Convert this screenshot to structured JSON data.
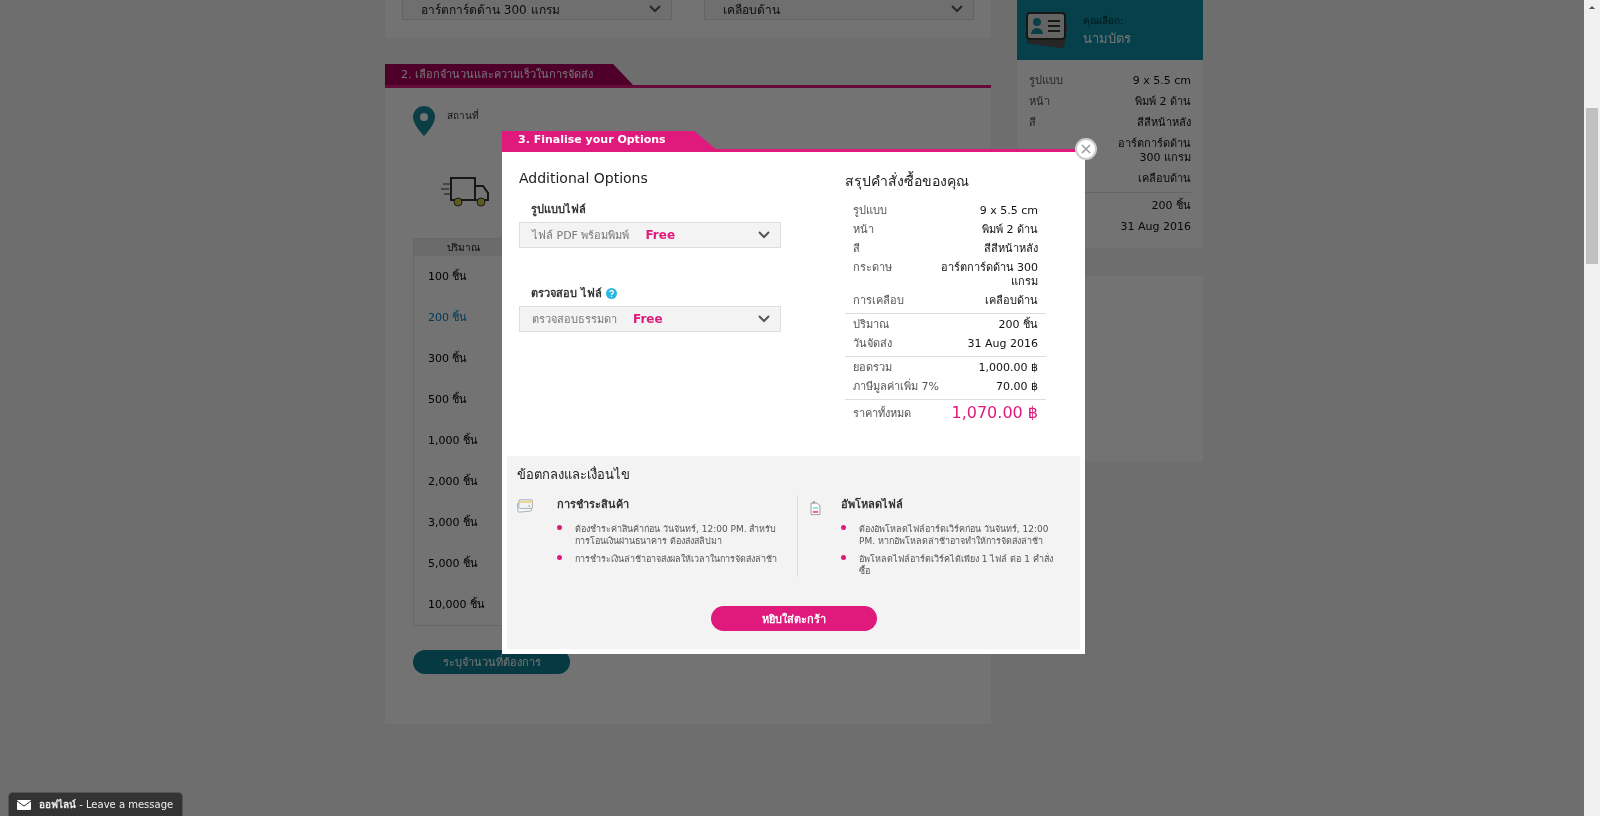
{
  "background": {
    "top_selects": [
      "อาร์ตการ์ดด้าน 300 แกรม",
      "เคลือบด้าน"
    ],
    "section_tab": "2. เลือกจำนวนและความเร็วในการจัดส่ง",
    "location_label": "สถานที่",
    "quantity": {
      "header": "ปริมาณ",
      "items": [
        {
          "label": "100 ชิ้น",
          "selected": false
        },
        {
          "label": "200 ชิ้น",
          "selected": true
        },
        {
          "label": "300 ชิ้น",
          "selected": false
        },
        {
          "label": "500 ชิ้น",
          "selected": false
        },
        {
          "label": "1,000 ชิ้น",
          "selected": false
        },
        {
          "label": "2,000 ชิ้น",
          "selected": false
        },
        {
          "label": "3,000 ชิ้น",
          "selected": false
        },
        {
          "label": "5,000 ชิ้น",
          "selected": false
        },
        {
          "label": "10,000 ชิ้น",
          "selected": false
        }
      ]
    },
    "custom_button": "ระบุจำนวนที่ต้องการ"
  },
  "sidebar": {
    "title_label": "คุณเลือก:",
    "product": "นามบัตร",
    "groups": [
      [
        {
          "label": "รูปแบบ",
          "value": "9 x 5.5 cm"
        },
        {
          "label": "หน้า",
          "value": "พิมพ์ 2 ด้าน"
        },
        {
          "label": "สี",
          "value": "สีสีหน้าหลัง"
        },
        {
          "value": "อาร์ตการ์ดด้าน 300 แกรม"
        },
        {
          "value": "เคลือบด้าน"
        }
      ],
      [
        {
          "value": "200  ชิ้น"
        },
        {
          "value": "31 Aug 2016"
        }
      ]
    ]
  },
  "modal": {
    "tab": "3. Finalise your Options",
    "options_title": "Additional Options",
    "options": [
      {
        "label": "รูปแบบไฟล์",
        "help": false,
        "value": "ไฟล์ PDF พร้อมพิมพ์",
        "price": "Free"
      },
      {
        "label": "ตรวจสอบ ไฟล์",
        "help": true,
        "value": "ตรวจสอบธรรมดา",
        "price": "Free"
      }
    ],
    "summary_title": "สรุปคำสั่งซื้อของคุณ",
    "summary_groups": [
      [
        {
          "label": "รูปแบบ",
          "value": "9 x 5.5 cm"
        },
        {
          "label": "หน้า",
          "value": "พิมพ์ 2 ด้าน"
        },
        {
          "label": "สี",
          "value": "สีสีหน้าหลัง"
        },
        {
          "label": "กระดาษ",
          "value": "อาร์ตการ์ดด้าน 300 แกรม"
        },
        {
          "label": "การเคลือบ",
          "value": "เคลือบด้าน"
        }
      ],
      [
        {
          "label": "ปริมาณ",
          "value": "200  ชิ้น"
        },
        {
          "label": "วันจัดส่ง",
          "value": "31 Aug 2016"
        }
      ],
      [
        {
          "label": "ยอดรวม",
          "value": "1,000.00 ฿"
        },
        {
          "label": "ภาษีมูลค่าเพิ่ม 7%",
          "value": "70.00 ฿"
        }
      ]
    ],
    "total": {
      "label": "ราคาทั้งหมด",
      "value": "1,070.00 ฿"
    },
    "terms_title": "ข้อตกลงและเงื่อนไข",
    "terms": [
      {
        "kind": "payment",
        "heading": "การชำระสินค้า",
        "bullets": [
          "ต้องชำระค่าสินค้าก่อน วันจันทร์, 12:00 PM. สำหรับการโอนเงินผ่านธนาคาร ต้องส่งสลิปมา",
          "การชำระเงินล่าช้าอาจส่งผลให้เวลาในการจัดส่งล่าช้า"
        ]
      },
      {
        "kind": "upload",
        "heading": "อัพโหลดไฟล์",
        "bullets": [
          "ต้องอัพโหลดไฟล์อาร์ตเวิร์คก่อน วันจันทร์, 12:00 PM. หากอัพโหลดล่าช้าอาจทำให้การจัดส่งล่าช้า",
          "อัพโหลดไฟล์อาร์ตเวิร์คได้เพียง 1 ไฟล์ ต่อ 1 คำสั่งซื้อ"
        ]
      }
    ],
    "cart_button": "หยิบใส่ตะกร้า"
  },
  "chat": {
    "label": "**ออฟไลน์** - Leave a message"
  }
}
